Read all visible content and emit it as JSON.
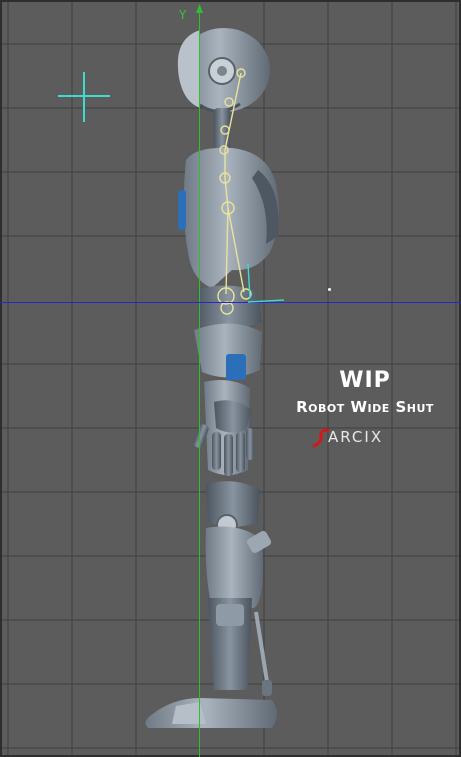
{
  "viewport": {
    "axis_label_y": "Y",
    "colors": {
      "background": "#5c5c5c",
      "grid": "#3e3e3e",
      "axis_y": "#2fbf2f",
      "axis_horizontal": "#2828c8",
      "crosshair": "#3fd9d0",
      "joint": "#e8e29a",
      "robot_body": "#8e9aa6",
      "accent_blue": "#2a6fb8"
    }
  },
  "title_overlay": {
    "title": "WIP",
    "subtitle": "Robot Wide Shut",
    "logo_text": "ARCIX",
    "logo_mark": "s-swoosh-icon"
  }
}
